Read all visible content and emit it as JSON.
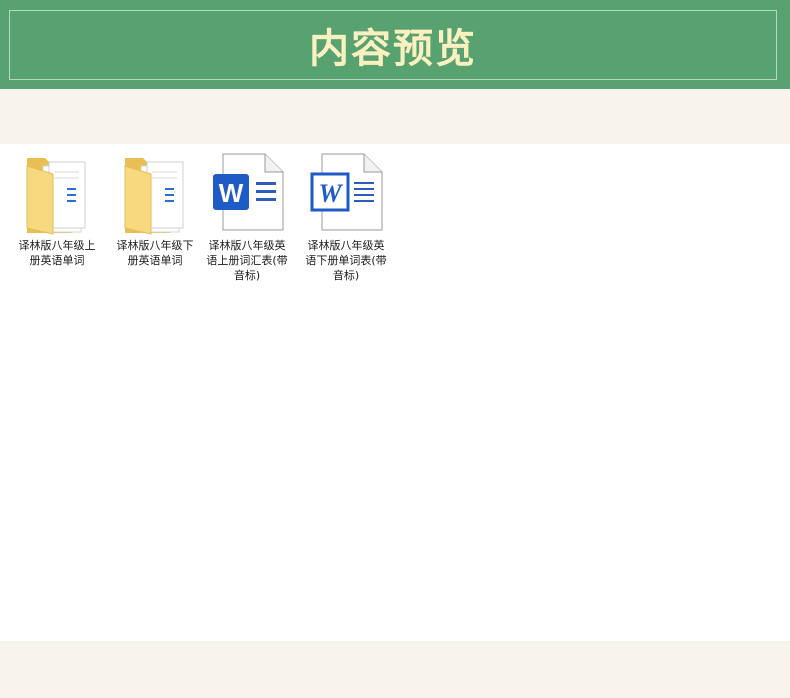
{
  "header": {
    "title": "内容预览"
  },
  "files": [
    {
      "name": "译林版八年级上册英语单词",
      "type": "folder",
      "icon": "folder-icon"
    },
    {
      "name": "译林版八年级下册英语单词",
      "type": "folder",
      "icon": "folder-icon"
    },
    {
      "name": "译林版八年级英语上册词汇表(带音标)",
      "type": "word-document",
      "icon": "word-document-icon"
    },
    {
      "name": "译林版八年级英语下册单词表(带音标)",
      "type": "word-document",
      "icon": "word-document-icon"
    }
  ],
  "colors": {
    "header_bg": "#58a272",
    "header_text": "#fbf0bf",
    "page_bg": "#f7f4ee",
    "folder_yellow": "#f6d67a",
    "word_blue": "#1e5bc6"
  }
}
